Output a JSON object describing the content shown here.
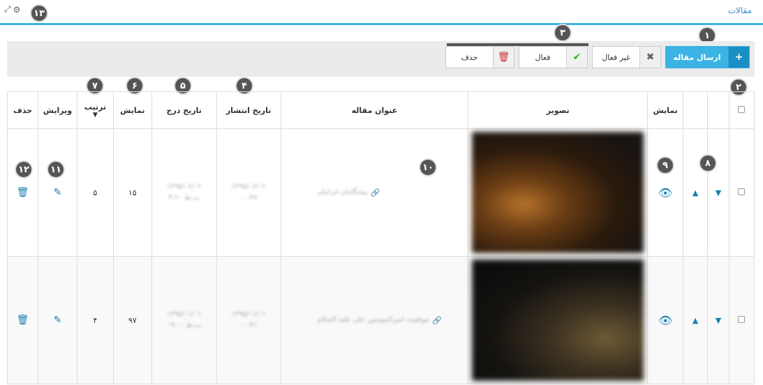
{
  "header": {
    "title": "مقالات"
  },
  "toolbar": {
    "add_label": "ارسال مقاله",
    "inactive_label": "غیر فعال",
    "active_label": "فعال",
    "delete_label": "حذف"
  },
  "badges": [
    "۱",
    "۲",
    "۳",
    "۴",
    "۵",
    "۶",
    "۷",
    "۸",
    "۹",
    "۱۰",
    "۱۱",
    "۱۲",
    "۱۳"
  ],
  "table": {
    "columns": {
      "display": "نمایش",
      "image": "تصویر",
      "title": "عنوان مقاله",
      "publish_date": "تاریخ انتشار",
      "insert_date": "تاریخ درج",
      "views": "نمایش",
      "order": "ترتیب",
      "edit": "ویرایش",
      "delete": "حذف"
    },
    "rows": [
      {
        "title": "پیشگامان ایرانیان",
        "publish_date": "۱۳۹۵/۰۶/۰۲",
        "publish_time": "۰۰:۴۷",
        "insert_date": "۱۳۹۵/۰۶/۰۲",
        "insert_time": "ب.ظ ۴:۱۰",
        "views": "۱۵",
        "order": "۵"
      },
      {
        "title": "موفقیت امیرالمومنین علی علیه السلام",
        "publish_date": "۱۳۹۵/۰۱/۰۱",
        "publish_time": "۰۰:۴۱",
        "insert_date": "۱۳۹۵/۰۱/۰۱",
        "insert_time": "ب.ظ ۰۹:۰۰",
        "views": "۹۷",
        "order": "۴"
      }
    ]
  }
}
